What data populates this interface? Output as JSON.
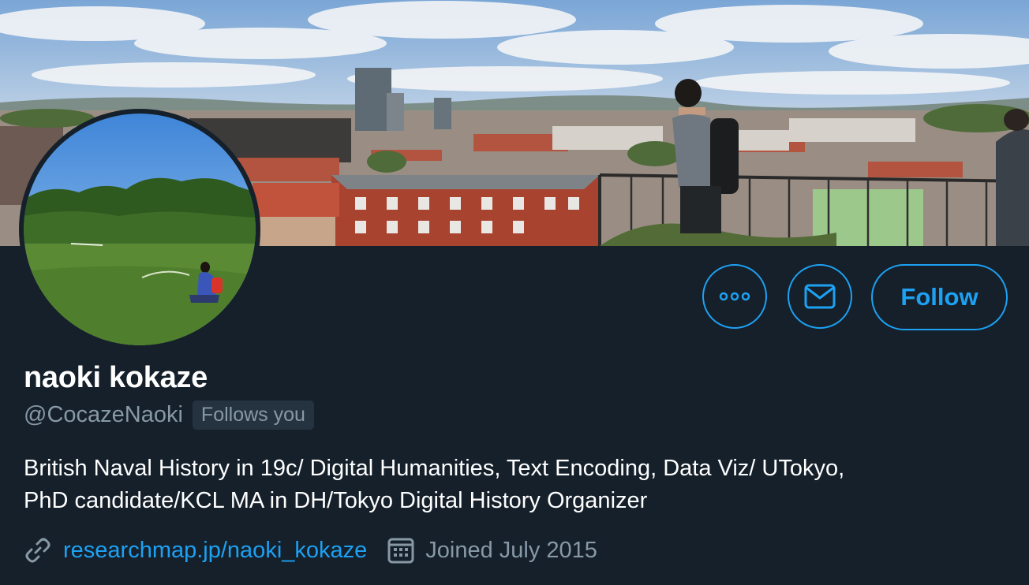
{
  "profile": {
    "display_name": "naoki kokaze",
    "handle": "@CocazeNaoki",
    "follows_you_badge": "Follows you",
    "bio_line1": "British Naval History in 19c/ Digital Humanities, Text Encoding, Data Viz/ UTokyo,",
    "bio_line2": "PhD candidate/KCL MA in DH/Tokyo Digital History Organizer",
    "website": "researchmap.jp/naoki_kokaze",
    "joined": "Joined July 2015"
  },
  "actions": {
    "follow_label": "Follow",
    "more_icon": "more-dots-icon",
    "message_icon": "envelope-icon"
  },
  "icons": {
    "link": "link-icon",
    "calendar": "calendar-icon"
  },
  "colors": {
    "background": "#15202b",
    "accent": "#1da1f2",
    "secondary_text": "#8899a6",
    "badge_bg": "#253341",
    "primary_text": "#ffffff"
  }
}
